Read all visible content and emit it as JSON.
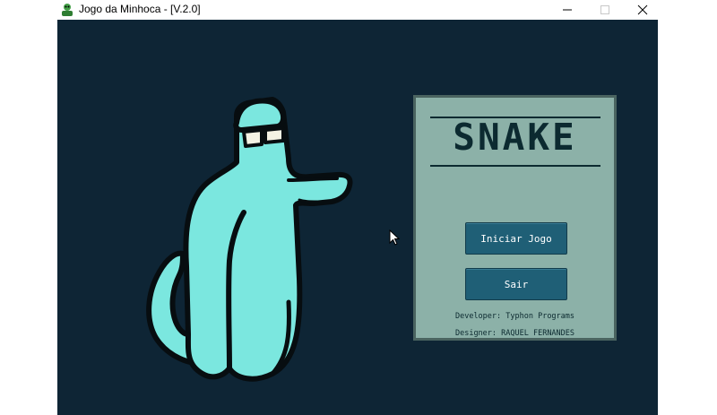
{
  "window": {
    "title": "Jogo da Minhoca - [V.2.0]",
    "app_icon": "worm-app-icon",
    "controls": [
      "minimize-icon",
      "maximize-icon",
      "close-icon"
    ]
  },
  "menu": {
    "logo": "SNAKE",
    "start_label": "Iniciar Jogo",
    "exit_label": "Sair",
    "developer_credit": "Developer: Typhon Programs",
    "designer_credit": "Designer: RAQUEL FERNANDES"
  },
  "colors": {
    "background": "#0e2535",
    "panel": "#8cb1a8",
    "button": "#1f5f76",
    "mascot": "#7be7df"
  }
}
